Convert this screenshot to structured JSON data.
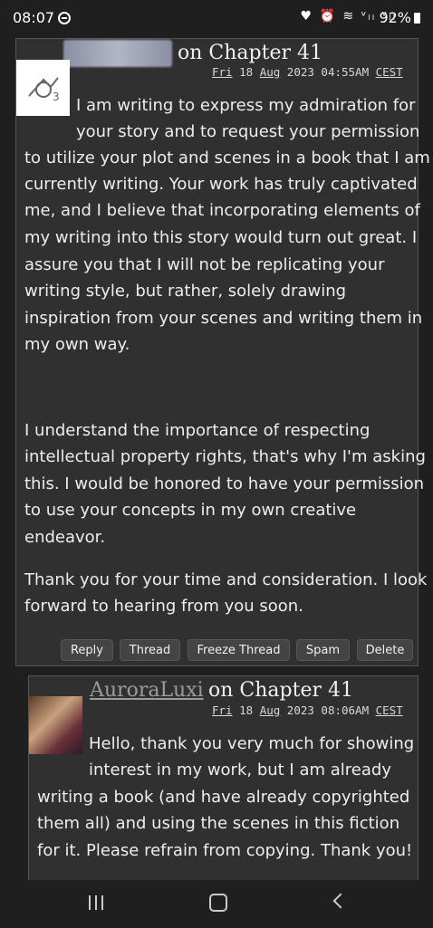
{
  "status_bar": {
    "time": "08:07",
    "icons": "♥ ⏰ ≋ ᵛₗₗ ᵛₗₗ",
    "battery": "92%"
  },
  "comment1": {
    "on_chapter": "on Chapter 41",
    "timestamp": {
      "day": "Fri",
      "date": " 18 ",
      "month": "Aug",
      "rest": " 2023 04:55AM ",
      "tz": "CEST"
    },
    "paragraph1": [
      "I am writing to express my admiration for",
      "your story and to request your permission",
      "to utilize your plot and scenes in a book that I am",
      "currently writing. Your work has truly captivated",
      "me, and I believe that incorporating elements of",
      "my writing into this story would turn out great. I",
      "assure you that I will not be replicating your",
      "writing style, but rather, solely drawing",
      "inspiration from your scenes and writing them in",
      "my own way."
    ],
    "paragraph2": [
      "I understand the importance of respecting",
      "intellectual property rights, that's why I'm asking",
      "this. I would be honored to have your permission",
      "to use your concepts in my own creative",
      "endeavor."
    ],
    "paragraph3": [
      "Thank you for your time and consideration. I look",
      "forward to hearing from you soon."
    ],
    "buttons": [
      "Reply",
      "Thread",
      "Freeze Thread",
      "Spam",
      "Delete"
    ]
  },
  "comment2": {
    "username": "AuroraLuxi",
    "on_chapter": "on Chapter 41",
    "timestamp": {
      "day": "Fri",
      "date": " 18 ",
      "month": "Aug",
      "rest": " 2023 08:06AM ",
      "tz": "CEST"
    },
    "paragraph1": [
      "Hello, thank you very much for showing",
      "interest in my work, but I am already",
      "writing a book (and have already copyrighted",
      "them all) and using the scenes in this fiction",
      "for it. Please refrain from copying. Thank you!"
    ]
  }
}
